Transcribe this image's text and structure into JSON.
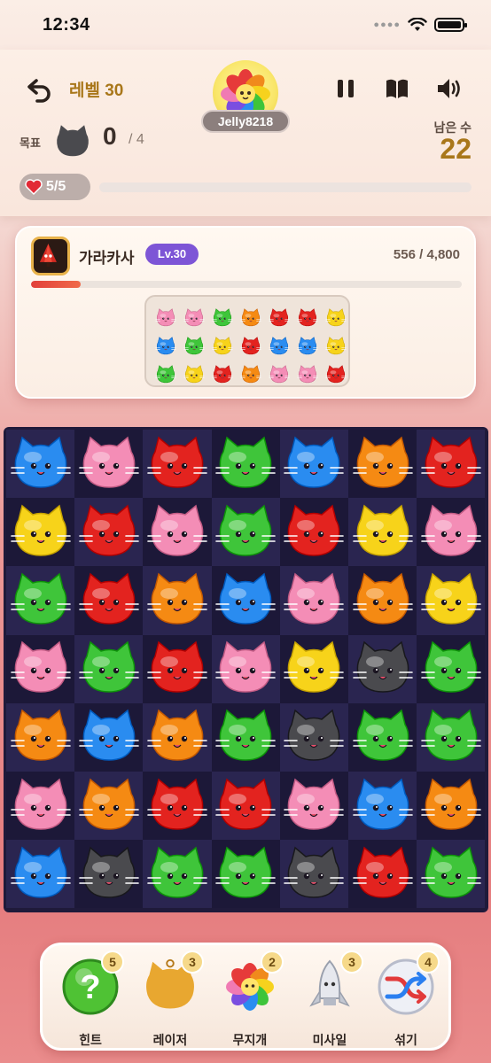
{
  "status_bar": {
    "time": "12:34"
  },
  "header": {
    "level": "레벨 30",
    "username": "Jelly8218",
    "goal_label": "목표",
    "goal_count": "0",
    "goal_total": "/ 4",
    "goal_target_color": "black",
    "moves_label": "남은 수",
    "moves_value": "22",
    "lives": "5/5",
    "lives_progress": 0
  },
  "boss": {
    "name": "가라카사",
    "level": "Lv.30",
    "hp_text": "556 / 4,800",
    "hp_fraction": 0.116,
    "preview_grid": [
      [
        "pink",
        "pink",
        "green",
        "orange",
        "red",
        "red",
        "yellow"
      ],
      [
        "blue",
        "green",
        "yellow",
        "red",
        "blue",
        "blue",
        "yellow"
      ],
      [
        "green",
        "yellow",
        "red",
        "orange",
        "pink",
        "pink",
        "red"
      ]
    ]
  },
  "board": {
    "rows": [
      [
        "blue",
        "pink",
        "red",
        "green",
        "blue",
        "orange",
        "red"
      ],
      [
        "yellow",
        "red",
        "pink",
        "green",
        "red",
        "yellow",
        "pink"
      ],
      [
        "green",
        "red",
        "orange",
        "blue",
        "pink",
        "orange",
        "yellow"
      ],
      [
        "pink",
        "green",
        "red",
        "pink",
        "yellow",
        "black",
        "green"
      ],
      [
        "orange",
        "blue",
        "orange",
        "green",
        "black",
        "green",
        "green"
      ],
      [
        "pink",
        "orange",
        "red",
        "red",
        "pink",
        "blue",
        "orange"
      ],
      [
        "blue",
        "black",
        "green",
        "green",
        "black",
        "red",
        "green"
      ]
    ]
  },
  "colors": {
    "red": "#e3231f",
    "pink": "#f48db6",
    "green": "#3fc53a",
    "blue": "#2a8cf0",
    "yellow": "#f7d31a",
    "orange": "#f58a13",
    "black": "#4a4a4e"
  },
  "toolbar": {
    "items": [
      {
        "label": "힌트",
        "count": "5",
        "icon": "hint-question-icon"
      },
      {
        "label": "레이저",
        "count": "3",
        "icon": "laser-cat-icon"
      },
      {
        "label": "무지개",
        "count": "2",
        "icon": "rainbow-flower-icon"
      },
      {
        "label": "미사일",
        "count": "3",
        "icon": "missile-icon"
      },
      {
        "label": "섞기",
        "count": "4",
        "icon": "shuffle-icon"
      }
    ]
  }
}
